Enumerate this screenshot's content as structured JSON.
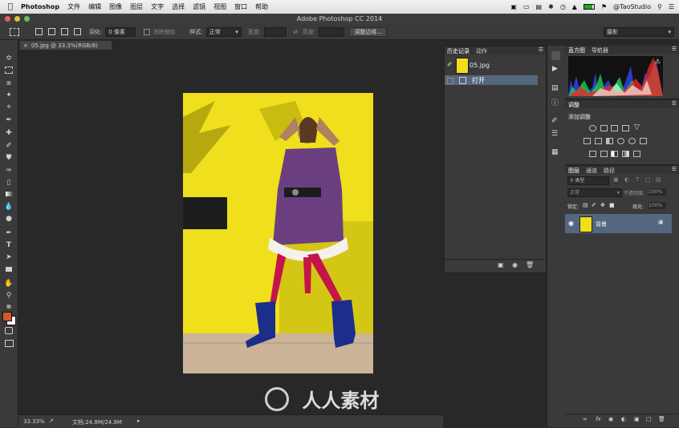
{
  "menubar": {
    "app_name": "Photoshop",
    "items": [
      "文件",
      "编辑",
      "图像",
      "图层",
      "文字",
      "选择",
      "滤镜",
      "视图",
      "窗口",
      "帮助"
    ],
    "user": "@TaoStudio"
  },
  "window": {
    "title": "Adobe Photoshop CC 2014"
  },
  "options_bar": {
    "feather_label": "羽化:",
    "feather_value": "0 像素",
    "antialias_label": "消除锯齿",
    "style_label": "样式:",
    "style_value": "正常",
    "width_label": "宽度:",
    "height_label": "高度:",
    "refine_edge": "调整边缘...",
    "workspace": "摄影"
  },
  "document": {
    "tab_label": "05.jpg @ 33.3%(RGB/8)",
    "zoom": "33.33%",
    "doc_info": "文档:24.8M/24.8M"
  },
  "history_panel": {
    "tabs": [
      "历史记录",
      "动作"
    ],
    "snapshot_label": "05.jpg",
    "steps": [
      "打开"
    ]
  },
  "histogram_panel": {
    "tabs": [
      "直方图",
      "导航器"
    ]
  },
  "adjustments_panel": {
    "tab": "调整",
    "heading": "添加调整"
  },
  "layers_panel": {
    "tabs": [
      "图层",
      "通道",
      "路径"
    ],
    "filter_label": "类型",
    "blend_mode": "正常",
    "opacity_label": "不透明度:",
    "opacity_value": "100%",
    "lock_label": "锁定:",
    "fill_label": "填充:",
    "fill_value": "100%",
    "layers": [
      {
        "name": "背景"
      }
    ]
  },
  "watermark": {
    "text": "人人素材"
  },
  "colors": {
    "foreground": "#d4572a",
    "background": "#ffffff",
    "selection": "#55677f"
  }
}
